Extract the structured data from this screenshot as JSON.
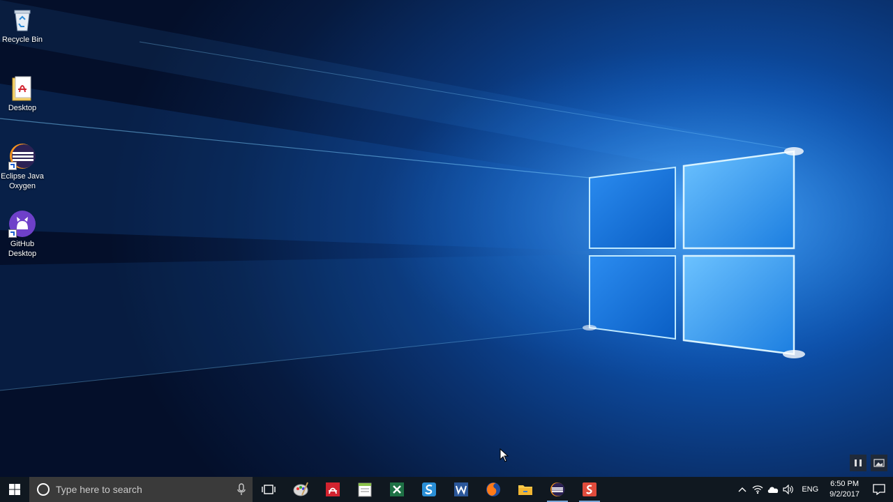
{
  "desktop": {
    "icons": [
      {
        "label": "Recycle Bin",
        "icon": "recycle-bin-icon"
      },
      {
        "label": "Desktop",
        "icon": "pdf-folder-icon"
      },
      {
        "label": "Eclipse Java Oxygen",
        "icon": "eclipse-icon"
      },
      {
        "label": "GitHub Desktop",
        "icon": "github-icon"
      }
    ]
  },
  "taskbar": {
    "search": {
      "placeholder": "Type here to search"
    },
    "apps": [
      {
        "name": "task-view",
        "icon": "task-view-icon"
      },
      {
        "name": "paint",
        "icon": "paint-icon"
      },
      {
        "name": "acrobat",
        "icon": "acrobat-icon"
      },
      {
        "name": "notepad-plus",
        "icon": "notepad-icon"
      },
      {
        "name": "excel",
        "icon": "excel-icon"
      },
      {
        "name": "snagit",
        "icon": "snagit-icon"
      },
      {
        "name": "word",
        "icon": "word-icon"
      },
      {
        "name": "firefox",
        "icon": "firefox-icon"
      },
      {
        "name": "file-explorer",
        "icon": "folder-icon"
      },
      {
        "name": "eclipse",
        "icon": "eclipse-icon"
      },
      {
        "name": "smartgit",
        "icon": "smartgit-icon"
      }
    ],
    "tray": {
      "language": "ENG",
      "time": "6:50 PM",
      "date": "9/2/2017"
    }
  },
  "colors": {
    "taskbar": "#101820",
    "search_bg": "#3a3a3a",
    "wallpaper_glow": "#7fd0ff",
    "accent": "#1f7fe0"
  }
}
